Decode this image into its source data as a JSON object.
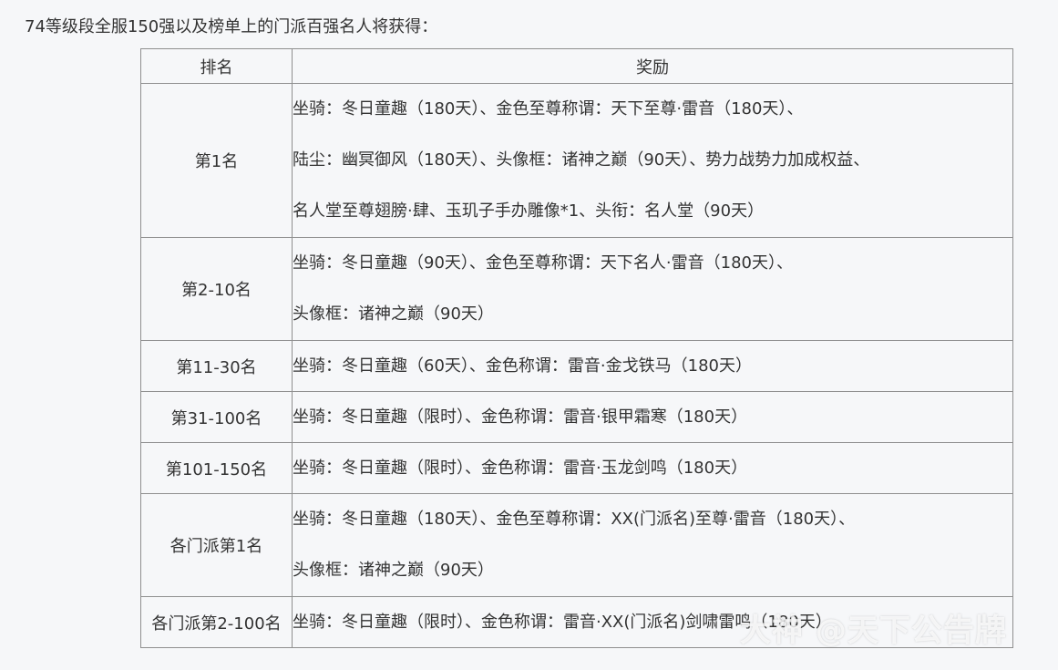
{
  "intro": "74等级段全服150强以及榜单上的门派百强名人将获得：",
  "table": {
    "headers": [
      "排名",
      "奖励"
    ],
    "rows": [
      {
        "rank": "第1名",
        "lines": [
          "坐骑：冬日童趣（180天）、金色至尊称谓：天下至尊·雷音（180天）、",
          "陆尘：幽冥御风（180天）、头像框：诸神之巅（90天）、势力战势力加成权益、",
          "名人堂至尊翅膀·肆、玉玑子手办雕像*1、头衔：名人堂（90天）"
        ]
      },
      {
        "rank": "第2-10名",
        "lines": [
          "坐骑：冬日童趣（90天）、金色至尊称谓：天下名人·雷音（180天）、",
          "头像框：诸神之巅（90天）"
        ]
      },
      {
        "rank": "第11-30名",
        "lines": [
          "坐骑：冬日童趣（60天）、金色称谓：雷音·金戈铁马（180天）"
        ]
      },
      {
        "rank": "第31-100名",
        "lines": [
          "坐骑：冬日童趣（限时）、金色称谓：雷音·银甲霜寒（180天）"
        ]
      },
      {
        "rank": "第101-150名",
        "lines": [
          "坐骑：冬日童趣（限时）、金色称谓：雷音·玉龙剑鸣（180天）"
        ]
      },
      {
        "rank": "各门派第1名",
        "lines": [
          "坐骑：冬日童趣（180天）、金色至尊称谓：XX(门派名)至尊·雷音（180天）、",
          "头像框：诸神之巅（90天）"
        ]
      },
      {
        "rank": "各门派第2-100名",
        "lines": [
          "坐骑：冬日童趣（限时）、金色称谓：雷音·XX(门派名)剑啸雷鸣（180天）"
        ]
      }
    ]
  },
  "watermark": "大神 @天下公告牌"
}
